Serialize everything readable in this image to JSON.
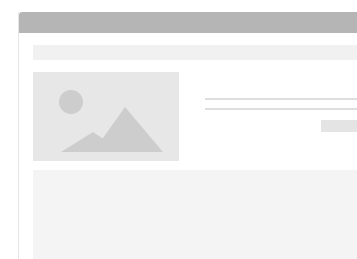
{
  "window": {
    "title": ""
  },
  "colors": {
    "titlebar": "#b5b5b5",
    "placeholder_fill": "#e7e7e7",
    "placeholder_icon": "#cdcdcd",
    "panel": "#f1f1f1",
    "content_area": "#f4f4f4"
  },
  "icons": {
    "media": "image-placeholder-icon"
  }
}
